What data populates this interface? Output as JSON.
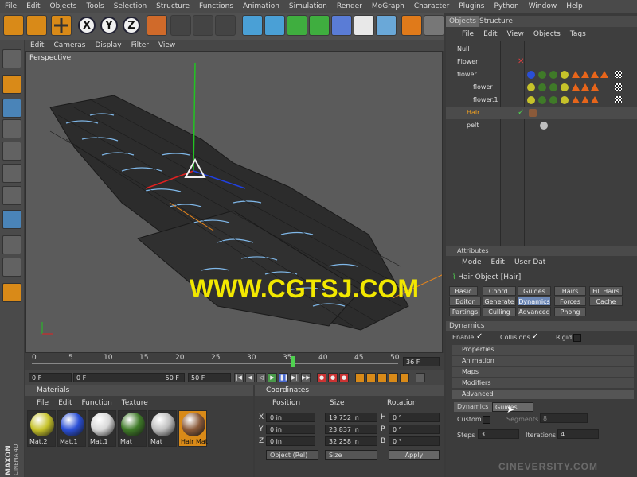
{
  "menu": [
    "File",
    "Edit",
    "Objects",
    "Tools",
    "Selection",
    "Structure",
    "Functions",
    "Animation",
    "Simulation",
    "Render",
    "MoGraph",
    "Character",
    "Plugins",
    "Python",
    "Window",
    "Help"
  ],
  "viewport": {
    "menu": [
      "Edit",
      "Cameras",
      "Display",
      "Filter",
      "View"
    ],
    "label": "Perspective",
    "watermark": "WWW.CGTSJ.COM"
  },
  "timeline": {
    "ticks": [
      "0",
      "5",
      "10",
      "15",
      "20",
      "25",
      "30",
      "35",
      "40",
      "45",
      "50"
    ],
    "end_field": "36 F",
    "current_frame": 36,
    "fields": [
      "0 F",
      "0 F",
      "50 F",
      "50 F"
    ]
  },
  "materials": {
    "title": "Materials",
    "menu": [
      "File",
      "Edit",
      "Function",
      "Texture"
    ],
    "items": [
      {
        "name": "Mat.2",
        "color": "#c6c22a"
      },
      {
        "name": "Mat.1",
        "color": "#2a4fd6"
      },
      {
        "name": "Mat.1",
        "color": "#d8d8d8"
      },
      {
        "name": "Mat",
        "color": "#3f7a28"
      },
      {
        "name": "Mat",
        "color": "#bfbfbf"
      },
      {
        "name": "Hair Mat",
        "color": "#8a5a3a",
        "selected": true
      }
    ]
  },
  "coords": {
    "title": "Coordinates",
    "headers": [
      "Position",
      "Size",
      "Rotation"
    ],
    "rows": [
      {
        "axis": "X",
        "pos": "0 in",
        "size": "19.752 in",
        "rot_label": "H",
        "rot": "0 °"
      },
      {
        "axis": "Y",
        "pos": "0 in",
        "size": "23.837 in",
        "rot_label": "P",
        "rot": "0 °"
      },
      {
        "axis": "Z",
        "pos": "0 in",
        "size": "32.258 in",
        "rot_label": "B",
        "rot": "0 °"
      }
    ],
    "mode": "Object (Rel)",
    "size_mode": "Size",
    "apply": "Apply"
  },
  "objects": {
    "tabs": [
      "Objects",
      "Structure"
    ],
    "menu": [
      "File",
      "Edit",
      "View",
      "Objects",
      "Tags"
    ],
    "items": [
      {
        "name": "Null",
        "indent": 0
      },
      {
        "name": "Flower",
        "indent": 0
      },
      {
        "name": "flower",
        "indent": 0
      },
      {
        "name": "flower",
        "indent": 1
      },
      {
        "name": "flower.1",
        "indent": 1
      },
      {
        "name": "Hair",
        "indent": 0,
        "highlight": true
      },
      {
        "name": "pelt",
        "indent": 0
      }
    ]
  },
  "attributes": {
    "title": "Attributes",
    "menu": [
      "Mode",
      "Edit",
      "User Dat"
    ],
    "object_title": "Hair Object [Hair]",
    "tabs": [
      [
        "Basic",
        "Coord.",
        "Guides",
        "Hairs",
        "Fill Hairs"
      ],
      [
        "Editor",
        "Generate",
        "Dynamics",
        "Forces",
        "Cache"
      ],
      [
        "Partings",
        "Culling",
        "Advanced",
        "Phong"
      ]
    ],
    "active_tab": "Dynamics",
    "section": "Dynamics",
    "enable": "Enable",
    "collisions": "Collisions",
    "rigid": "Rigid",
    "groups": [
      "Properties",
      "Animation",
      "Maps",
      "Modifiers",
      "Advanced"
    ],
    "adv_dynamics": "Dynamics",
    "adv_select": "Guides",
    "custom": "Custom",
    "segments": "Segments",
    "segments_val": "8",
    "steps": "Steps",
    "steps_val": "3",
    "iterations": "Iterations",
    "iterations_val": "4"
  },
  "brand": {
    "maxon": "MAXON",
    "product": "CINEMA 4D",
    "cineversity": "CINEVERSITY.COM"
  }
}
